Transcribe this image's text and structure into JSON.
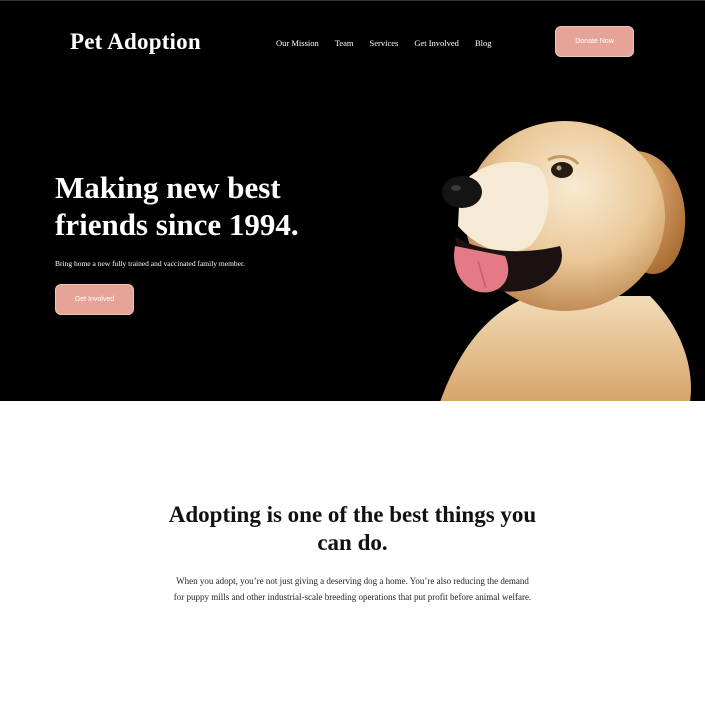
{
  "header": {
    "logo": "Pet Adoption",
    "nav": [
      "Our Mission",
      "Team",
      "Services",
      "Get Involved",
      "Blog"
    ],
    "donate_label": "Donate Now"
  },
  "hero": {
    "headline": "Making new best friends since 1994.",
    "subline": "Bring home a new fully trained and vaccinated family member.",
    "cta_label": "Get Involved",
    "image": "golden-retriever-photo"
  },
  "section": {
    "title": "Adopting is one of the best things you can do.",
    "body": "When you adopt, you’re not just giving a deserving dog a home. You’re also reducing the demand for puppy mills and other industrial-scale breeding operations that put profit before animal welfare."
  },
  "colors": {
    "accent": "#e6a498",
    "hero_bg": "#000000",
    "page_bg": "#ffffff"
  }
}
